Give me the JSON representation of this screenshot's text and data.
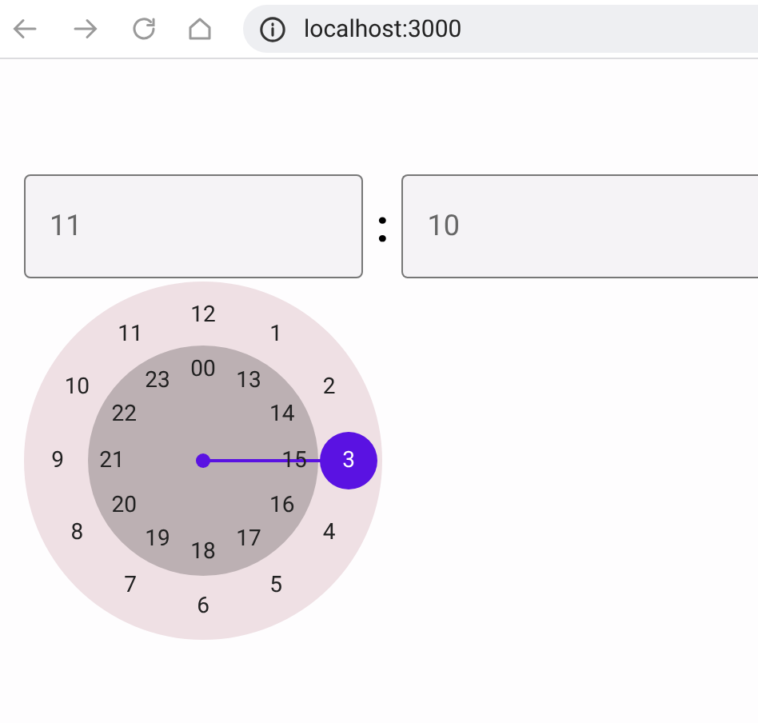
{
  "browser": {
    "url": "localhost:3000"
  },
  "time_fields": [
    {
      "value": "11"
    },
    {
      "value": "10"
    }
  ],
  "separator": ":",
  "clock": {
    "outer": [
      {
        "label": "12",
        "selected": false
      },
      {
        "label": "1",
        "selected": false
      },
      {
        "label": "2",
        "selected": false
      },
      {
        "label": "3",
        "selected": true
      },
      {
        "label": "4",
        "selected": false
      },
      {
        "label": "5",
        "selected": false
      },
      {
        "label": "6",
        "selected": false
      },
      {
        "label": "7",
        "selected": false
      },
      {
        "label": "8",
        "selected": false
      },
      {
        "label": "9",
        "selected": false
      },
      {
        "label": "10",
        "selected": false
      },
      {
        "label": "11",
        "selected": false
      }
    ],
    "inner": [
      {
        "label": "00",
        "selected": false
      },
      {
        "label": "13",
        "selected": false
      },
      {
        "label": "14",
        "selected": false
      },
      {
        "label": "15",
        "selected": false
      },
      {
        "label": "16",
        "selected": false
      },
      {
        "label": "17",
        "selected": false
      },
      {
        "label": "18",
        "selected": false
      },
      {
        "label": "19",
        "selected": false
      },
      {
        "label": "20",
        "selected": false
      },
      {
        "label": "21",
        "selected": false
      },
      {
        "label": "22",
        "selected": false
      },
      {
        "label": "23",
        "selected": false
      }
    ]
  }
}
